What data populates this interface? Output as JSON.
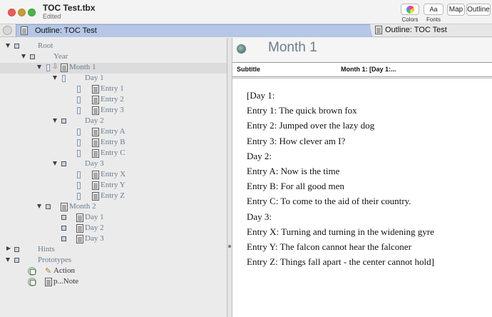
{
  "window": {
    "title": "TOC Test.tbx",
    "status": "Edited"
  },
  "toolbar": {
    "colors_label": "Colors",
    "fonts_button": "Aa",
    "fonts_label": "Fonts",
    "map_label": "Map",
    "outline_label": "Outline"
  },
  "tabs": [
    {
      "label": "Outline: TOC Test",
      "active": true
    },
    {
      "label": "Outline: TOC Test",
      "active": false
    }
  ],
  "outline": {
    "rows": [
      {
        "label": "Root"
      },
      {
        "label": "Year"
      },
      {
        "label": "Month  1"
      },
      {
        "label": "Day 1"
      },
      {
        "label": "Entry 1"
      },
      {
        "label": "Entry 2"
      },
      {
        "label": "Entry 3"
      },
      {
        "label": "Day 2"
      },
      {
        "label": "Entry A"
      },
      {
        "label": "Entry B"
      },
      {
        "label": "Entry C"
      },
      {
        "label": "Day 3"
      },
      {
        "label": "Entry X"
      },
      {
        "label": "Entry Y"
      },
      {
        "label": "Entry Z"
      },
      {
        "label": "Month 2"
      },
      {
        "label": "Day 1"
      },
      {
        "label": "Day 2"
      },
      {
        "label": "Day 3"
      },
      {
        "label": "Hints"
      },
      {
        "label": "Prototypes"
      },
      {
        "label": "Action"
      },
      {
        "label": "p...Note"
      }
    ]
  },
  "note": {
    "title": "Month  1",
    "attribute": {
      "name": "Subtitle",
      "value": "Month  1: [Day 1:..."
    },
    "lines": [
      "[Day 1:",
      "Entry 1: The quick brown fox",
      "Entry 2: Jumped over the lazy dog",
      "Entry 3: How clever am I?",
      "Day 2:",
      "Entry A: Now is the time",
      "Entry B: For all good men",
      "Entry C: To come to the aid of their country.",
      "Day 3:",
      "Entry X: Turning and turning in the widening gyre",
      "Entry Y: The falcon cannot hear the falconer",
      "Entry Z: Things fall apart - the center cannot hold]"
    ]
  },
  "colors": {
    "tab_active": "#b5c6e6",
    "outline_text": "#6b7c8c",
    "close": "#ee5b54",
    "minimize": "#c99b3a",
    "zoom": "#48b548"
  }
}
